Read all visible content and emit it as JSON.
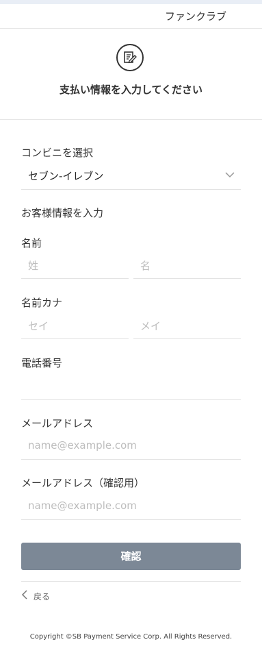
{
  "header": {
    "title": "ファンクラブ"
  },
  "hero": {
    "icon": "edit-document-icon",
    "heading": "支払い情報を入力してください"
  },
  "store": {
    "label": "コンビニを選択",
    "selected": "セブン-イレブン"
  },
  "customer_section": {
    "label": "お客様情報を入力"
  },
  "name": {
    "label": "名前",
    "last_placeholder": "姓",
    "first_placeholder": "名"
  },
  "kana": {
    "label": "名前カナ",
    "last_placeholder": "セイ",
    "first_placeholder": "メイ"
  },
  "phone": {
    "label": "電話番号",
    "value": ""
  },
  "email": {
    "label": "メールアドレス",
    "placeholder": "name@example.com"
  },
  "email_confirm": {
    "label": "メールアドレス（確認用）",
    "placeholder": "name@example.com"
  },
  "actions": {
    "confirm_label": "確認",
    "back_label": "戻る"
  },
  "footer": {
    "copyright": "Copyright ©SB Payment Service Corp. All Rights Reserved."
  },
  "colors": {
    "button": "#7c8896",
    "border": "#e3e3e3",
    "placeholder": "#bdbdbd"
  }
}
